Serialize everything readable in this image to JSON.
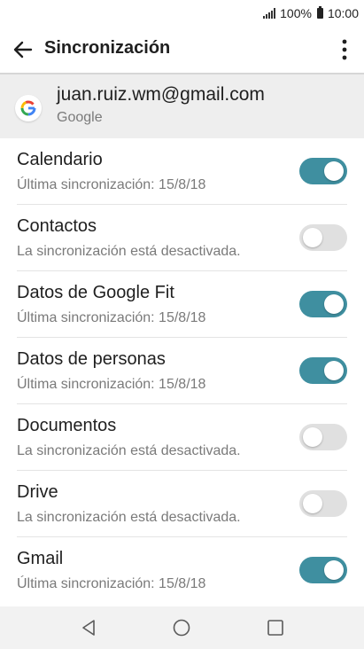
{
  "status_bar": {
    "battery": "100%",
    "time": "10:00"
  },
  "app_bar": {
    "title": "Sincronización"
  },
  "account": {
    "email": "juan.ruiz.wm@gmail.com",
    "provider": "Google"
  },
  "sync_items": [
    {
      "title": "Calendario",
      "subtitle": "Última sincronización: 15/8/18",
      "enabled": true
    },
    {
      "title": "Contactos",
      "subtitle": "La sincronización está desactivada.",
      "enabled": false
    },
    {
      "title": "Datos de Google Fit",
      "subtitle": "Última sincronización: 15/8/18",
      "enabled": true
    },
    {
      "title": "Datos de personas",
      "subtitle": "Última sincronización: 15/8/18",
      "enabled": true
    },
    {
      "title": "Documentos",
      "subtitle": "La sincronización está desactivada.",
      "enabled": false
    },
    {
      "title": "Drive",
      "subtitle": "La sincronización está desactivada.",
      "enabled": false
    },
    {
      "title": "Gmail",
      "subtitle": "Última sincronización: 15/8/18",
      "enabled": true
    }
  ],
  "colors": {
    "toggle_on": "#3f8fa0",
    "toggle_off": "#e0e0e0"
  },
  "nav_bar": {
    "icons": [
      "back-icon",
      "home-icon",
      "recents-icon"
    ]
  }
}
